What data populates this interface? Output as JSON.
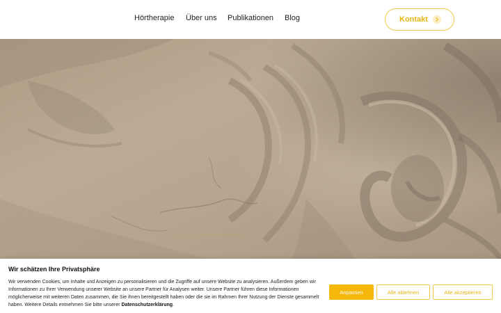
{
  "nav": {
    "items": [
      {
        "label": "Hörtherapie"
      },
      {
        "label": "Über uns"
      },
      {
        "label": "Publikationen"
      },
      {
        "label": "Blog"
      }
    ],
    "contact_label": "Kontakt",
    "contact_icon": "chevron-right-icon"
  },
  "hero": {
    "image": "stone-relief-photo"
  },
  "cookie": {
    "title": "Wir schätzen Ihre Privatsphäre",
    "text": "Wir verwenden Cookies, um Inhalte und Anzeigen zu personalisieren und die Zugriffe auf unsere Website zu analysieren. Außerdem geben wir Informationen zu Ihrer Verwendung unserer Website an unsere Partner für Analysen weiter. Unsere Partner führen diese Informationen möglicherweise mit weiteren Daten zusammen, die Sie ihnen bereitgestellt haben oder die sie im Rahmen Ihrer Nutzung der Dienste gesammelt haben. Weitere Details entnehmen Sie bitte unserer",
    "link_label": "Datenschutzerklärung",
    "buttons": {
      "adjust": "Anpassen",
      "reject": "Alle ablehnen",
      "accept": "Alle akzeptieren"
    }
  },
  "colors": {
    "accent": "#f5b80b",
    "accent_border": "#f2c94c",
    "text": "#222222"
  }
}
